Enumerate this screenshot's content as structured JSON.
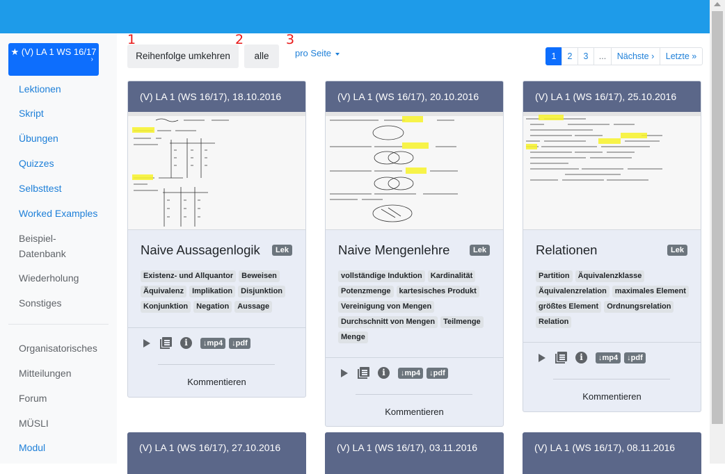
{
  "sidebar": {
    "lecture": "★ (V) LA 1 WS 16/17",
    "lecture_chevron": "›",
    "items": [
      {
        "label": "Lektionen"
      },
      {
        "label": "Skript"
      },
      {
        "label": "Übungen"
      },
      {
        "label": "Quizzes"
      },
      {
        "label": "Selbsttest"
      },
      {
        "label": "Worked Examples"
      },
      {
        "label": "Beispiel-Datenbank"
      },
      {
        "label": "Wiederholung"
      },
      {
        "label": "Sonstiges"
      }
    ],
    "items2": [
      {
        "label": "Organisatorisches"
      },
      {
        "label": "Mitteilungen"
      },
      {
        "label": "Forum"
      },
      {
        "label": "MÜSLI"
      },
      {
        "label": "Modul"
      }
    ]
  },
  "toolbar": {
    "reverse": "Reihenfolge umkehren",
    "all": "alle",
    "per_page": "pro Seite",
    "annotations": [
      "1",
      "2",
      "3"
    ]
  },
  "pagination": [
    "1",
    "2",
    "3",
    "...",
    "Nächste ›",
    "Letzte »"
  ],
  "cards": [
    {
      "header": "(V) LA 1 (WS 16/17), 18.10.2016",
      "title": "Naive Aussagenlogik",
      "badge": "Lek",
      "tags": [
        "Existenz- und Allquantor",
        "Beweisen",
        "Äquivalenz",
        "Implikation",
        "Disjunktion",
        "Konjunktion",
        "Negation",
        "Aussage"
      ],
      "mp4": "↓mp4",
      "pdf": "↓pdf",
      "comment": "Kommentieren"
    },
    {
      "header": "(V) LA 1 (WS 16/17), 20.10.2016",
      "title": "Naive Mengenlehre",
      "badge": "Lek",
      "tags": [
        "vollständige Induktion",
        "Kardinalität",
        "Potenzmenge",
        "kartesisches Produkt",
        "Vereinigung von Mengen",
        "Durchschnitt von Mengen",
        "Teilmenge",
        "Menge"
      ],
      "mp4": "↓mp4",
      "pdf": "↓pdf",
      "comment": "Kommentieren"
    },
    {
      "header": "(V) LA 1 (WS 16/17), 25.10.2016",
      "title": "Relationen",
      "badge": "Lek",
      "tags": [
        "Partition",
        "Äquivalenzklasse",
        "Äquivalenzrelation",
        "maximales Element",
        "größtes Element",
        "Ordnungsrelation",
        "Relation"
      ],
      "mp4": "↓mp4",
      "pdf": "↓pdf",
      "comment": "Kommentieren"
    }
  ],
  "next_cards": [
    {
      "header": "(V) LA 1 (WS 16/17), 27.10.2016"
    },
    {
      "header": "(V) LA 1 (WS 16/17), 03.11.2016"
    },
    {
      "header": "(V) LA 1 (WS 16/17), 08.11.2016"
    }
  ],
  "colors": {
    "topbar": "#1e9be9",
    "primary": "#0d6efd",
    "card_header": "#5b6789",
    "card_body": "#e9edf6",
    "link": "#1d7fd8",
    "annotation": "#e81818"
  }
}
